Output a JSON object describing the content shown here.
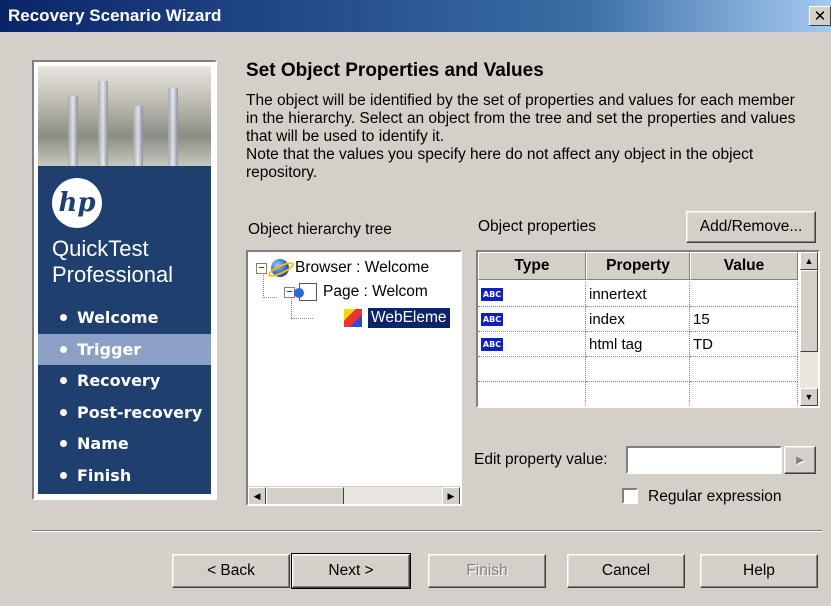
{
  "window": {
    "title": "Recovery Scenario Wizard",
    "close_glyph": "✕"
  },
  "sidebar": {
    "logo_text": "hp",
    "product_line1": "QuickTest",
    "product_line2": "Professional",
    "steps": [
      {
        "label": "Welcome",
        "active": false
      },
      {
        "label": "Trigger",
        "active": true
      },
      {
        "label": "Recovery",
        "active": false
      },
      {
        "label": "Post-recovery",
        "active": false
      },
      {
        "label": "Name",
        "active": false
      },
      {
        "label": "Finish",
        "active": false
      }
    ]
  },
  "page": {
    "heading": "Set Object Properties and Values",
    "description_1": "The object will be identified by the set of properties and values for each member in the hierarchy. Select an object from the tree and set the properties and values that will be used to identify it.",
    "description_2": "Note that the values you specify here do not affect any object in the object repository."
  },
  "tree": {
    "label": "Object hierarchy tree",
    "nodes": [
      {
        "label": "Browser : Welcome",
        "icon": "browser-icon",
        "expander": "−"
      },
      {
        "label": "Page : Welcom",
        "icon": "page-icon",
        "expander": "−"
      },
      {
        "label": "WebEleme",
        "icon": "web-element-icon",
        "selected": true
      }
    ]
  },
  "properties": {
    "label": "Object properties",
    "add_remove_label": "Add/Remove...",
    "columns": [
      "Type",
      "Property",
      "Value"
    ],
    "type_badge": "ABC",
    "rows": [
      {
        "property": "innertext",
        "value": ""
      },
      {
        "property": "index",
        "value": "15"
      },
      {
        "property": "html tag",
        "value": "TD"
      }
    ]
  },
  "edit": {
    "label": "Edit property value:",
    "value": "",
    "regex_label": "Regular expression",
    "regex_checked": false
  },
  "buttons": {
    "back": "< Back",
    "next": "Next >",
    "finish": "Finish",
    "cancel": "Cancel",
    "help": "Help"
  }
}
